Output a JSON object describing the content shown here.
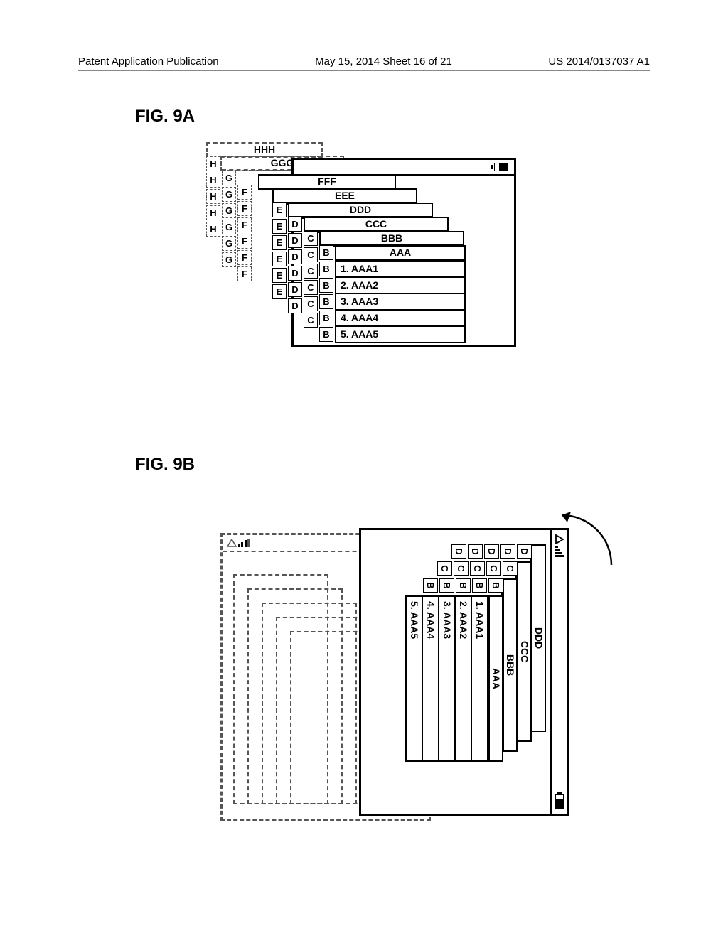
{
  "header": {
    "left": "Patent Application Publication",
    "center": "May 15, 2014  Sheet 16 of 21",
    "right": "US 2014/0137037 A1"
  },
  "fig9a": {
    "label": "FIG. 9A",
    "cards": {
      "hhh": "HHH",
      "ggg": "GGG",
      "fff": "FFF",
      "eee": "EEE",
      "ddd": "DDD",
      "ccc": "CCC",
      "bbb": "BBB",
      "aaa": "AAA"
    },
    "sideLetters": {
      "h": "H",
      "g": "G",
      "f": "F",
      "e": "E",
      "d": "D",
      "c": "C",
      "b": "B"
    },
    "items": [
      "1. AAA1",
      "2. AAA2",
      "3. AAA3",
      "4. AAA4",
      "5. AAA5"
    ]
  },
  "fig9b": {
    "label": "FIG. 9B",
    "cards": {
      "ddd": "DDD",
      "ccc": "CCC",
      "bbb": "BBB",
      "aaa": "AAA"
    },
    "sideLetters": {
      "d": "D",
      "c": "C",
      "b": "B"
    },
    "items": [
      "1. AAA1",
      "2. AAA2",
      "3. AAA3",
      "4. AAA4",
      "5. AAA5"
    ]
  }
}
